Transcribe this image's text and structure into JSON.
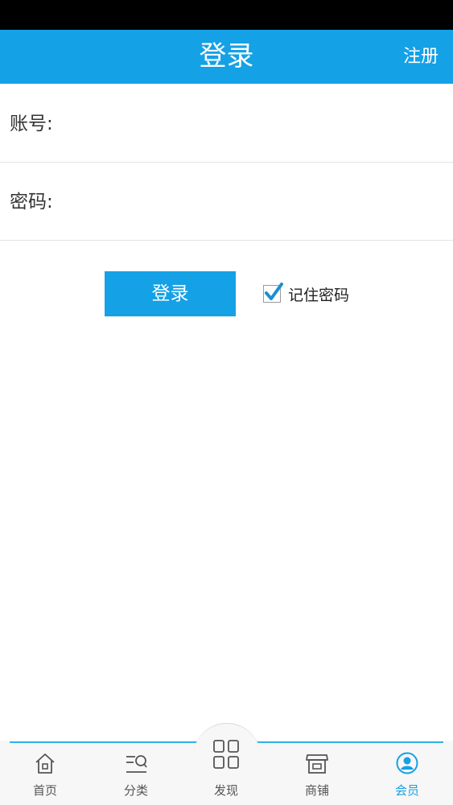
{
  "header": {
    "title": "登录",
    "register_label": "注册"
  },
  "form": {
    "account_label": "账号:",
    "account_value": "",
    "password_label": "密码:",
    "password_value": ""
  },
  "actions": {
    "login_label": "登录",
    "remember_label": "记住密码",
    "remember_checked": true
  },
  "tabbar": {
    "items": [
      {
        "label": "首页",
        "icon": "home-icon",
        "active": false
      },
      {
        "label": "分类",
        "icon": "category-icon",
        "active": false
      },
      {
        "label": "发现",
        "icon": "grid-icon",
        "active": false
      },
      {
        "label": "商铺",
        "icon": "shop-icon",
        "active": false
      },
      {
        "label": "会员",
        "icon": "user-icon",
        "active": true
      }
    ]
  },
  "colors": {
    "accent": "#14a1e6",
    "status_bar": "#000000",
    "tabbar_bg": "#f7f7f7"
  }
}
